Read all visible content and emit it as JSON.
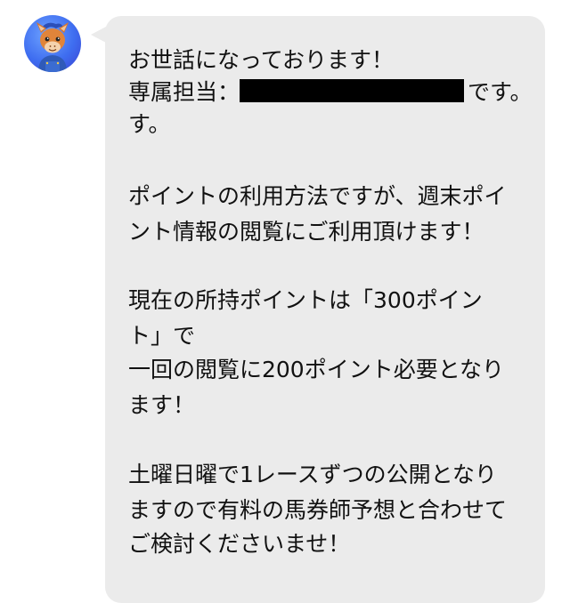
{
  "message": {
    "lines": [
      "お世話になっております！",
      "専属担当：",
      "です。",
      "す。",
      "ポイントの利用方法ですが、週末ポイ",
      "ント情報の閲覧にご利用頂けます！",
      "現在の所持ポイントは「300ポイン",
      "ト」で",
      "一回の閲覧に200ポイント必要となり",
      "ます！",
      "土曜日曜で1レースずつの公開となり",
      "ますので有料の馬券師予想と合わせて",
      "ご検討くださいませ！"
    ]
  },
  "colors": {
    "bubble": "#ebebeb",
    "text": "#111111",
    "avatar_bg": "#3e6df0",
    "redaction": "#000000"
  },
  "icons": {
    "avatar": "horse-mascot-avatar"
  }
}
